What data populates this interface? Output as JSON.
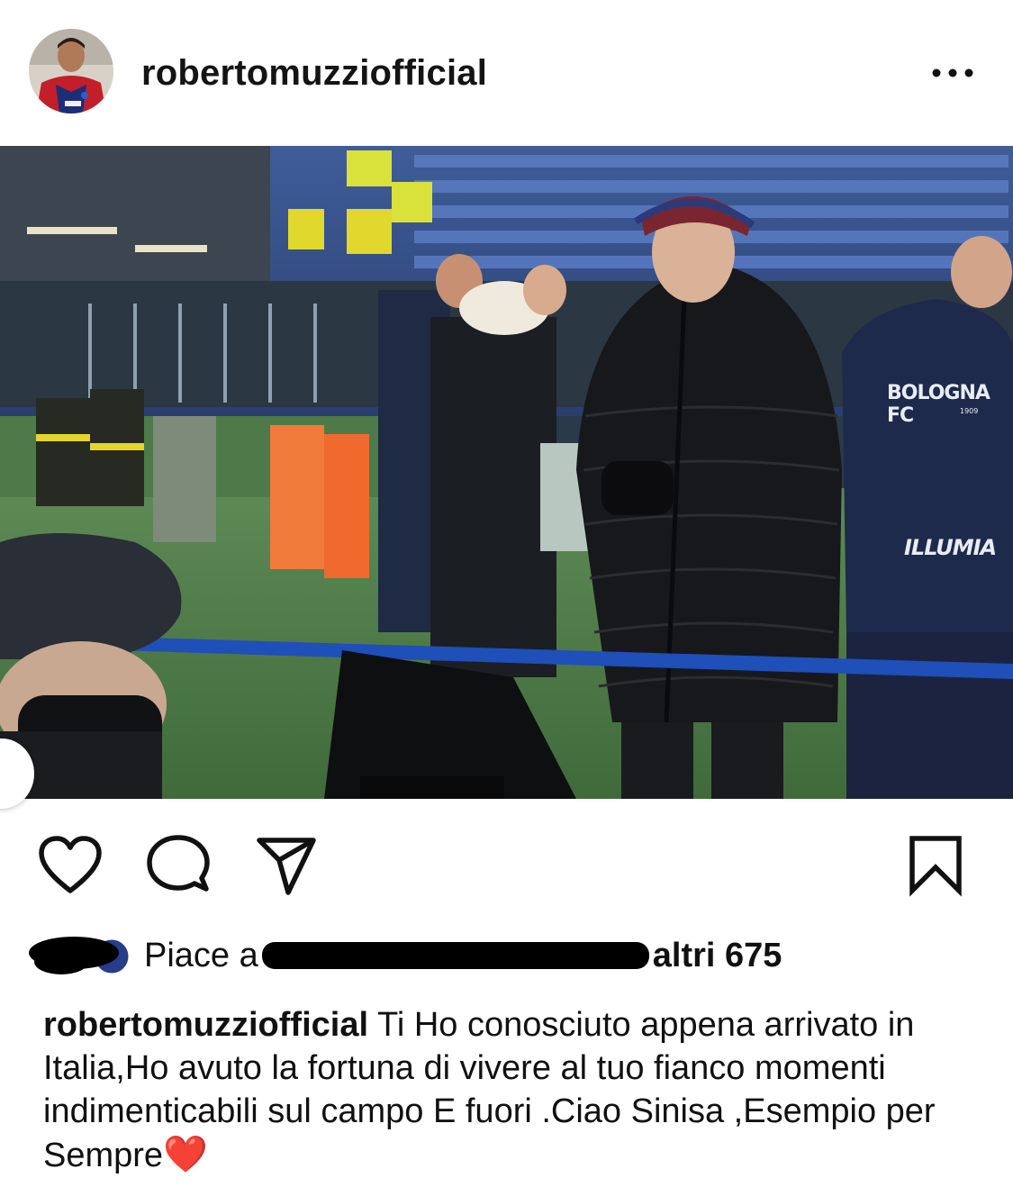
{
  "post": {
    "username": "robertomuzziofficial",
    "avatar_icon": "profile-photo",
    "more_icon": "more-horizontal-icon",
    "photo_description_icon": "post-photo"
  },
  "photo_text": {
    "jacket_brand": "BOLOGNA FC",
    "jacket_year": "1909",
    "sponsor": "ILLUMIA"
  },
  "actions": {
    "like_icon": "heart-outline-icon",
    "comment_icon": "comment-bubble-icon",
    "share_icon": "paper-plane-icon",
    "save_icon": "bookmark-icon"
  },
  "likes": {
    "prefix": "Piace a",
    "suffix": " altri 675",
    "count_label": "altri 675"
  },
  "caption": {
    "user": "robertomuzziofficial",
    "text": "Ti Ho conosciuto appena arrivato in Italia,Ho avuto la fortuna di vivere al tuo fianco momenti indimenticabili sul campo E fuori .Ciao Sinisa ,Esempio per Sempre",
    "emoji": "❤️"
  },
  "colors": {
    "text": "#111111",
    "heart": "#e02424",
    "barrier": "#1f4fb8"
  }
}
